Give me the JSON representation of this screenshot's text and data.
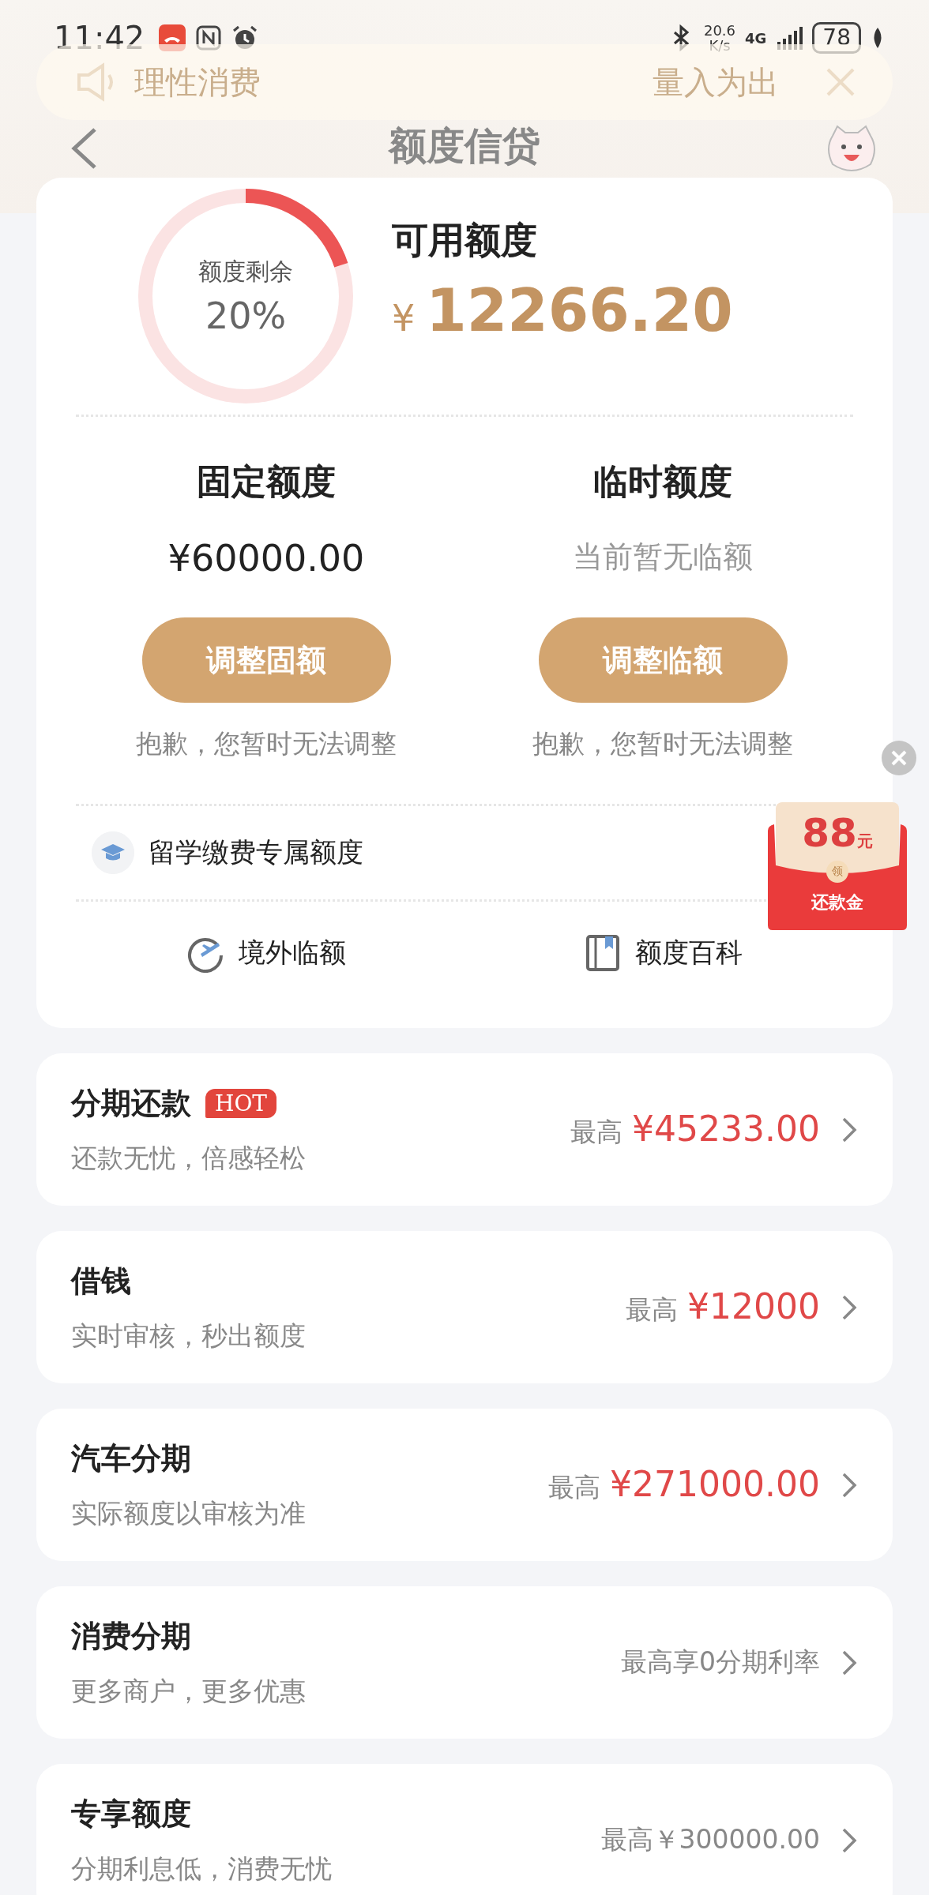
{
  "status_bar": {
    "time": "11:42",
    "speed_value": "20.6",
    "speed_unit": "K/s",
    "network": "4G",
    "battery": "78"
  },
  "notice": {
    "text_left": "理性消费",
    "text_right": "量入为出"
  },
  "header": {
    "title": "额度信贷"
  },
  "summary": {
    "ring_label": "额度剩余",
    "ring_value": "20%",
    "level": 0.2,
    "available_label": "可用额度",
    "currency": "¥",
    "amount": "12266.20"
  },
  "quotas": [
    {
      "kind": "amount",
      "title": "固定额度",
      "value": "¥60000.00",
      "button": "调整固额",
      "note": "抱歉，您暂时无法调整"
    },
    {
      "kind": "empty",
      "title": "临时额度",
      "value": "当前暂无临额",
      "button": "调整临额",
      "note": "抱歉，您暂时无法调整"
    }
  ],
  "study": {
    "label": "留学缴费专属额度"
  },
  "links": [
    {
      "kind": "plane",
      "label": "境外临额"
    },
    {
      "kind": "book",
      "label": "额度百科"
    }
  ],
  "promo": {
    "amount": "88",
    "unit": "元",
    "seal": "领",
    "label": "还款金"
  },
  "products": [
    {
      "kind": "highlight",
      "title": "分期还款",
      "badge": "HOT",
      "subtitle": "还款无忧，倍感轻松",
      "prefix": "最高",
      "value": "¥45233.00"
    },
    {
      "kind": "highlight",
      "title": "借钱",
      "subtitle": "实时审核，秒出额度",
      "prefix": "最高",
      "value": "¥12000"
    },
    {
      "kind": "highlight",
      "title": "汽车分期",
      "subtitle": "实际额度以审核为准",
      "prefix": "最高",
      "value": "¥271000.00"
    },
    {
      "kind": "plain",
      "title": "消费分期",
      "subtitle": "更多商户，更多优惠",
      "value": "最高享0分期利率"
    },
    {
      "kind": "plain",
      "title": "专享额度",
      "subtitle": "分期利息低，消费无忧",
      "value": "最高￥300000.00"
    }
  ]
}
